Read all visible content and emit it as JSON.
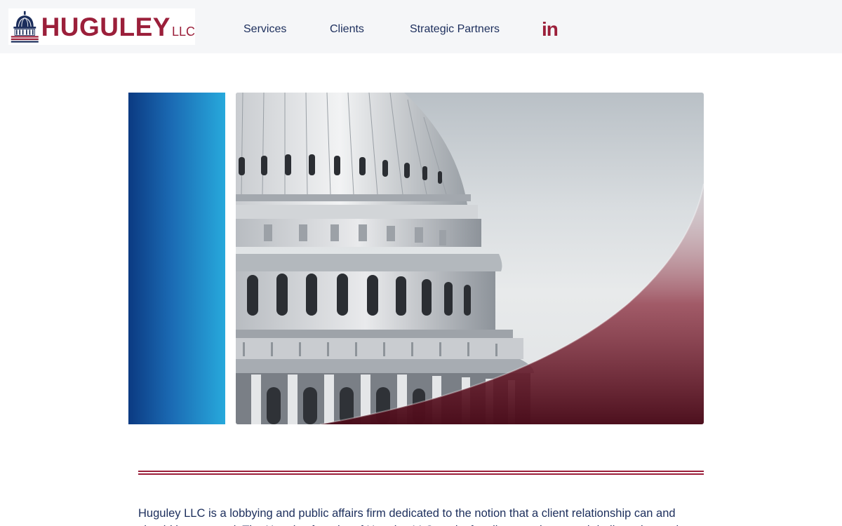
{
  "brand": {
    "name": "HUGULEY",
    "suffix": "LLC"
  },
  "nav": {
    "items": [
      {
        "label": "Services"
      },
      {
        "label": "Clients"
      },
      {
        "label": "Strategic Partners"
      }
    ],
    "social": {
      "label": "in",
      "icon": "linkedin-icon"
    }
  },
  "colors": {
    "brand_red": "#9b1f3a",
    "brand_navy": "#1c2e5c",
    "accent_blue": "#27a9dc",
    "header_bg": "#f5f6f8"
  },
  "intro": {
    "text": "Huguley LLC is a lobbying and public affairs firm dedicated to the notion that a client relationship can and should be personal. The Huguley founder of Huguley LLC works for clients and personal dedicated to and"
  }
}
